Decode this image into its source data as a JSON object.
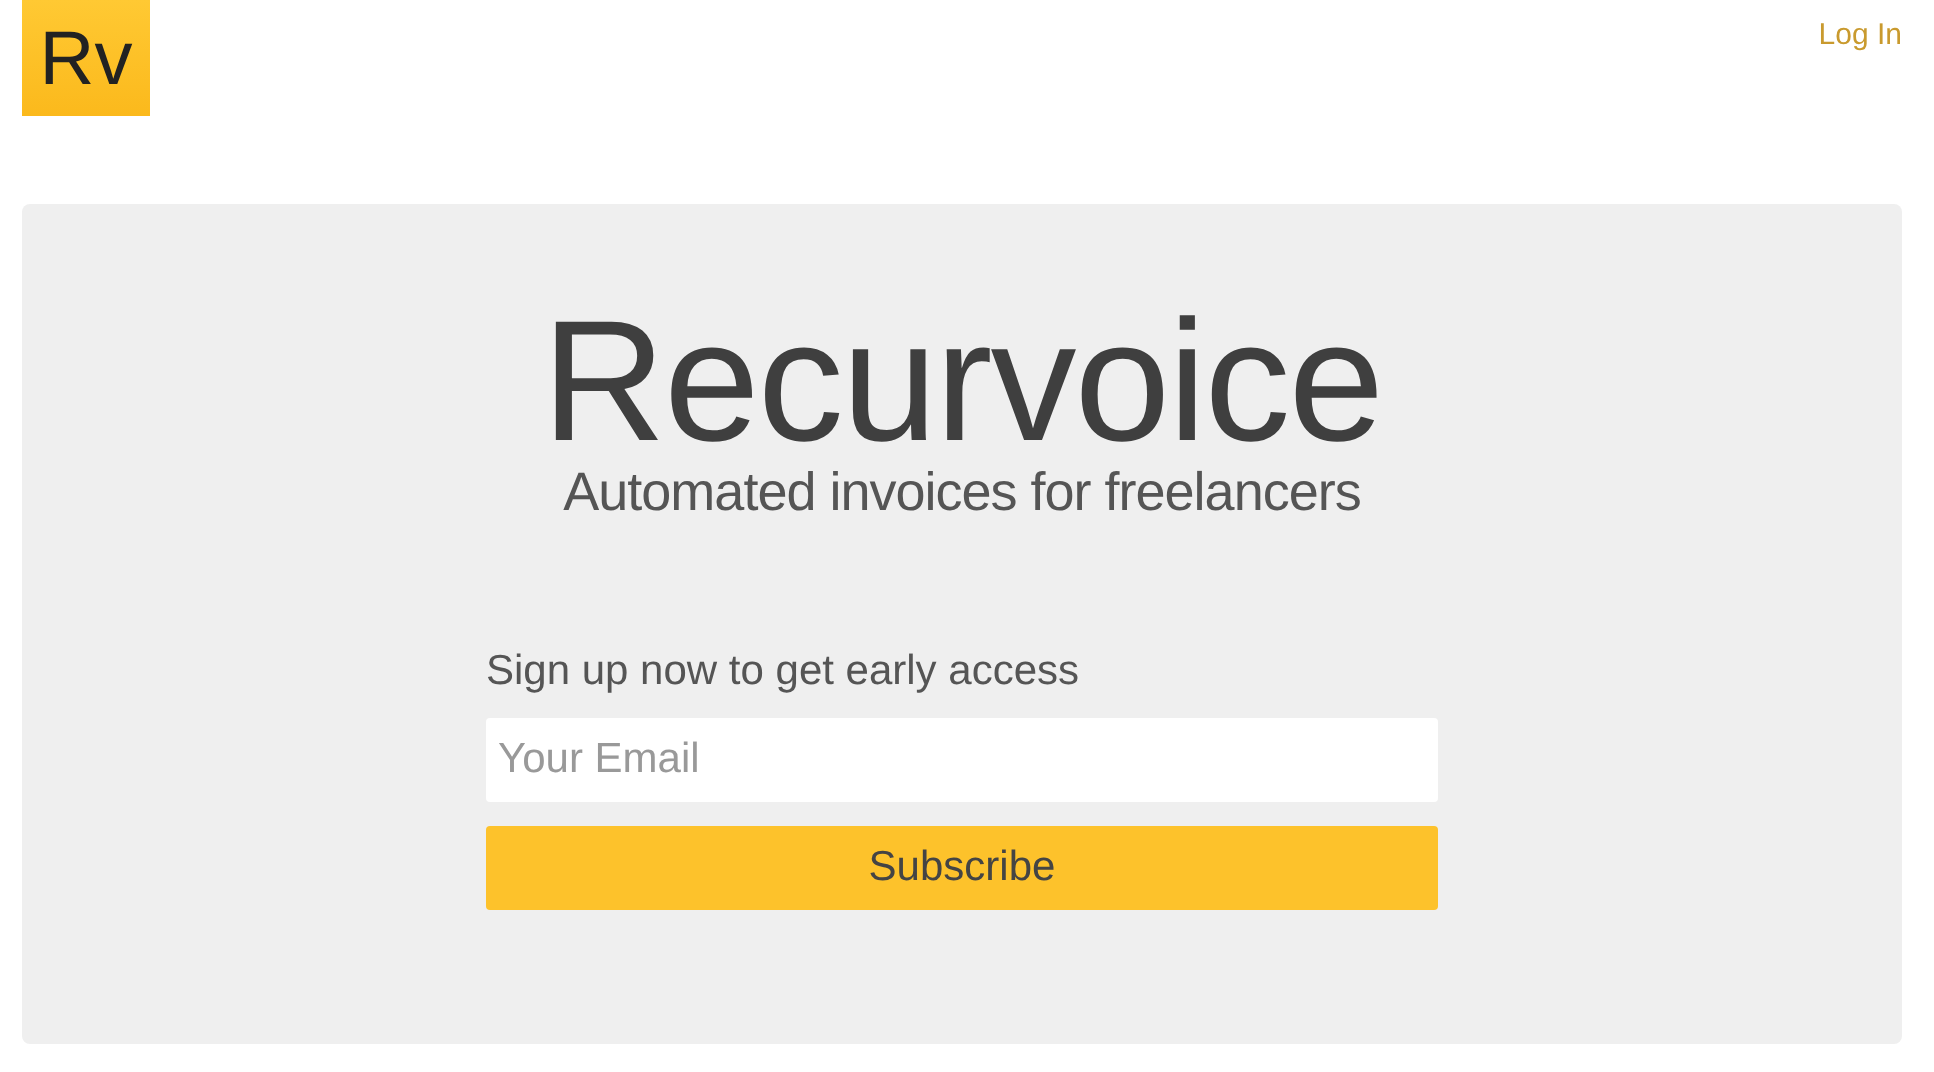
{
  "header": {
    "logo": "Rv",
    "login_link": "Log In"
  },
  "hero": {
    "title": "Recurvoice",
    "subtitle": "Automated invoices for freelancers"
  },
  "signup": {
    "label": "Sign up now to get early access",
    "email": {
      "placeholder": "Your Email"
    },
    "button": "Subscribe"
  }
}
